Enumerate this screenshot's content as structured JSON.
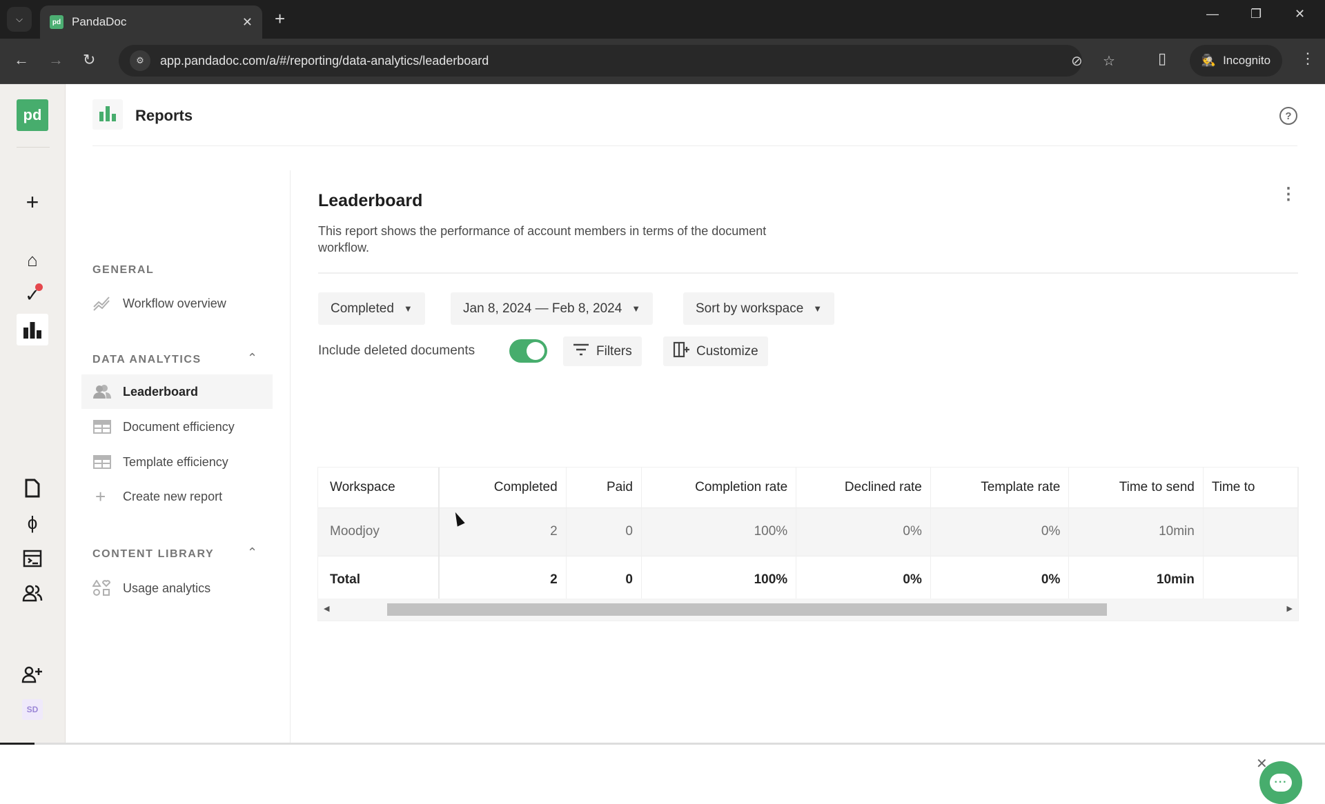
{
  "browser": {
    "tab_title": "PandaDoc",
    "tab_favicon": "pd",
    "url": "app.pandadoc.com/a/#/reporting/data-analytics/leaderboard",
    "profile_label": "Incognito",
    "icons": {
      "tab_search": "chevron-down",
      "close_tab": "✕",
      "new_tab": "+",
      "back": "←",
      "forward": "→",
      "reload": "↻",
      "eye_off": "eye-off",
      "star": "☆",
      "side_panel": "▯",
      "menu": "⋮",
      "minimize": "—",
      "restore": "❐",
      "close_window": "✕"
    }
  },
  "rail": {
    "logo": "pd",
    "avatar_initials": "SD",
    "items": [
      {
        "name": "create",
        "glyph": "+"
      },
      {
        "name": "home",
        "glyph": "⌂"
      },
      {
        "name": "tasks",
        "glyph": "✓",
        "badge": true
      },
      {
        "name": "reports",
        "glyph": "▮",
        "active": true
      },
      {
        "name": "documents",
        "glyph": "▯"
      },
      {
        "name": "automations",
        "glyph": "ϟ"
      },
      {
        "name": "templates",
        "glyph": "▤"
      },
      {
        "name": "contacts",
        "glyph": "👥"
      },
      {
        "name": "invite-user",
        "glyph": "+"
      }
    ]
  },
  "header": {
    "title": "Reports",
    "help": "?"
  },
  "subnav": {
    "sections": [
      {
        "title": "GENERAL",
        "collapsible": false,
        "items": [
          {
            "label": "Workflow overview",
            "icon": "trend-line-icon"
          }
        ]
      },
      {
        "title": "DATA ANALYTICS",
        "collapsible": true,
        "items": [
          {
            "label": "Leaderboard",
            "icon": "users-icon",
            "active": true
          },
          {
            "label": "Document efficiency",
            "icon": "table-icon"
          },
          {
            "label": "Template efficiency",
            "icon": "table-icon"
          },
          {
            "label": "Create new report",
            "icon": "plus-icon"
          }
        ]
      },
      {
        "title": "CONTENT LIBRARY",
        "collapsible": true,
        "items": [
          {
            "label": "Usage analytics",
            "icon": "shapes-icon"
          }
        ]
      }
    ]
  },
  "main": {
    "title": "Leaderboard",
    "description": "This report shows the performance of account members in terms of the document workflow.",
    "filters": {
      "status": "Completed",
      "date_range": "Jan 8, 2024 — Feb 8, 2024",
      "sort": "Sort by workspace",
      "include_deleted_label": "Include deleted documents",
      "include_deleted": true,
      "filters_label": "Filters",
      "customize_label": "Customize"
    },
    "table": {
      "columns": [
        "Workspace",
        "Completed",
        "Paid",
        "Completion rate",
        "Declined rate",
        "Template rate",
        "Time to send",
        "Time to"
      ],
      "rows": [
        [
          "Moodjoy",
          "2",
          "0",
          "100%",
          "0%",
          "0%",
          "10min",
          ""
        ]
      ],
      "total": [
        "Total",
        "2",
        "0",
        "100%",
        "0%",
        "0%",
        "10min",
        ""
      ]
    }
  }
}
